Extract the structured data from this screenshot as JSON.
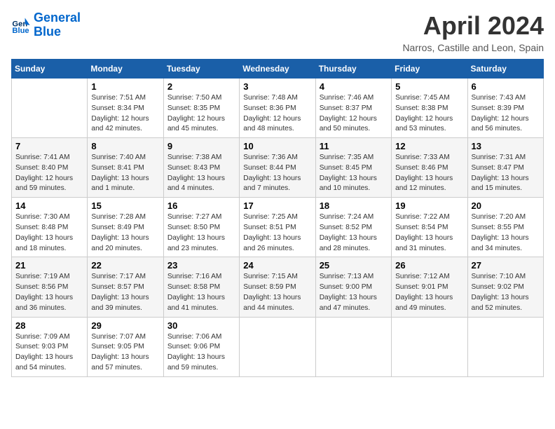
{
  "logo": {
    "line1": "General",
    "line2": "Blue"
  },
  "title": "April 2024",
  "subtitle": "Narros, Castille and Leon, Spain",
  "days_header": [
    "Sunday",
    "Monday",
    "Tuesday",
    "Wednesday",
    "Thursday",
    "Friday",
    "Saturday"
  ],
  "weeks": [
    [
      {
        "num": "",
        "info": ""
      },
      {
        "num": "1",
        "info": "Sunrise: 7:51 AM\nSunset: 8:34 PM\nDaylight: 12 hours\nand 42 minutes."
      },
      {
        "num": "2",
        "info": "Sunrise: 7:50 AM\nSunset: 8:35 PM\nDaylight: 12 hours\nand 45 minutes."
      },
      {
        "num": "3",
        "info": "Sunrise: 7:48 AM\nSunset: 8:36 PM\nDaylight: 12 hours\nand 48 minutes."
      },
      {
        "num": "4",
        "info": "Sunrise: 7:46 AM\nSunset: 8:37 PM\nDaylight: 12 hours\nand 50 minutes."
      },
      {
        "num": "5",
        "info": "Sunrise: 7:45 AM\nSunset: 8:38 PM\nDaylight: 12 hours\nand 53 minutes."
      },
      {
        "num": "6",
        "info": "Sunrise: 7:43 AM\nSunset: 8:39 PM\nDaylight: 12 hours\nand 56 minutes."
      }
    ],
    [
      {
        "num": "7",
        "info": "Sunrise: 7:41 AM\nSunset: 8:40 PM\nDaylight: 12 hours\nand 59 minutes."
      },
      {
        "num": "8",
        "info": "Sunrise: 7:40 AM\nSunset: 8:41 PM\nDaylight: 13 hours\nand 1 minute."
      },
      {
        "num": "9",
        "info": "Sunrise: 7:38 AM\nSunset: 8:43 PM\nDaylight: 13 hours\nand 4 minutes."
      },
      {
        "num": "10",
        "info": "Sunrise: 7:36 AM\nSunset: 8:44 PM\nDaylight: 13 hours\nand 7 minutes."
      },
      {
        "num": "11",
        "info": "Sunrise: 7:35 AM\nSunset: 8:45 PM\nDaylight: 13 hours\nand 10 minutes."
      },
      {
        "num": "12",
        "info": "Sunrise: 7:33 AM\nSunset: 8:46 PM\nDaylight: 13 hours\nand 12 minutes."
      },
      {
        "num": "13",
        "info": "Sunrise: 7:31 AM\nSunset: 8:47 PM\nDaylight: 13 hours\nand 15 minutes."
      }
    ],
    [
      {
        "num": "14",
        "info": "Sunrise: 7:30 AM\nSunset: 8:48 PM\nDaylight: 13 hours\nand 18 minutes."
      },
      {
        "num": "15",
        "info": "Sunrise: 7:28 AM\nSunset: 8:49 PM\nDaylight: 13 hours\nand 20 minutes."
      },
      {
        "num": "16",
        "info": "Sunrise: 7:27 AM\nSunset: 8:50 PM\nDaylight: 13 hours\nand 23 minutes."
      },
      {
        "num": "17",
        "info": "Sunrise: 7:25 AM\nSunset: 8:51 PM\nDaylight: 13 hours\nand 26 minutes."
      },
      {
        "num": "18",
        "info": "Sunrise: 7:24 AM\nSunset: 8:52 PM\nDaylight: 13 hours\nand 28 minutes."
      },
      {
        "num": "19",
        "info": "Sunrise: 7:22 AM\nSunset: 8:54 PM\nDaylight: 13 hours\nand 31 minutes."
      },
      {
        "num": "20",
        "info": "Sunrise: 7:20 AM\nSunset: 8:55 PM\nDaylight: 13 hours\nand 34 minutes."
      }
    ],
    [
      {
        "num": "21",
        "info": "Sunrise: 7:19 AM\nSunset: 8:56 PM\nDaylight: 13 hours\nand 36 minutes."
      },
      {
        "num": "22",
        "info": "Sunrise: 7:17 AM\nSunset: 8:57 PM\nDaylight: 13 hours\nand 39 minutes."
      },
      {
        "num": "23",
        "info": "Sunrise: 7:16 AM\nSunset: 8:58 PM\nDaylight: 13 hours\nand 41 minutes."
      },
      {
        "num": "24",
        "info": "Sunrise: 7:15 AM\nSunset: 8:59 PM\nDaylight: 13 hours\nand 44 minutes."
      },
      {
        "num": "25",
        "info": "Sunrise: 7:13 AM\nSunset: 9:00 PM\nDaylight: 13 hours\nand 47 minutes."
      },
      {
        "num": "26",
        "info": "Sunrise: 7:12 AM\nSunset: 9:01 PM\nDaylight: 13 hours\nand 49 minutes."
      },
      {
        "num": "27",
        "info": "Sunrise: 7:10 AM\nSunset: 9:02 PM\nDaylight: 13 hours\nand 52 minutes."
      }
    ],
    [
      {
        "num": "28",
        "info": "Sunrise: 7:09 AM\nSunset: 9:03 PM\nDaylight: 13 hours\nand 54 minutes."
      },
      {
        "num": "29",
        "info": "Sunrise: 7:07 AM\nSunset: 9:05 PM\nDaylight: 13 hours\nand 57 minutes."
      },
      {
        "num": "30",
        "info": "Sunrise: 7:06 AM\nSunset: 9:06 PM\nDaylight: 13 hours\nand 59 minutes."
      },
      {
        "num": "",
        "info": ""
      },
      {
        "num": "",
        "info": ""
      },
      {
        "num": "",
        "info": ""
      },
      {
        "num": "",
        "info": ""
      }
    ]
  ]
}
